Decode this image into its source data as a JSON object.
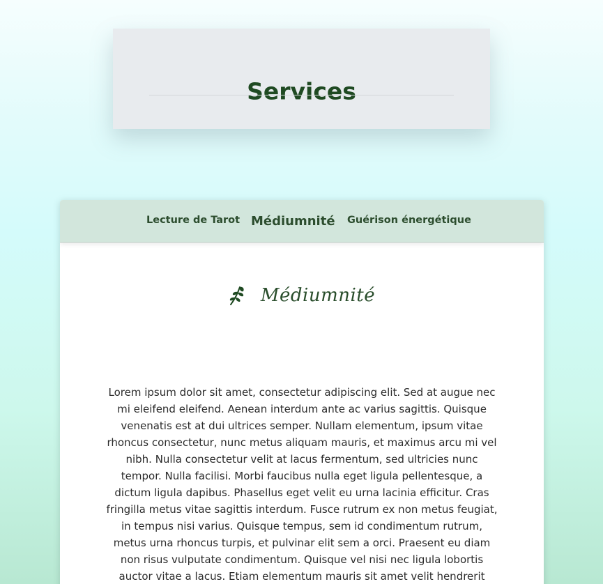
{
  "hero": {
    "title": "Services"
  },
  "tabs": [
    {
      "label": "Lecture de Tarot",
      "active": false
    },
    {
      "label": "Médiumnité",
      "active": true
    },
    {
      "label": "Guérison énergétique",
      "active": false
    }
  ],
  "section": {
    "icon": "leaf-branch-icon",
    "title": "Médiumnité",
    "body": "Lorem ipsum dolor sit amet, consectetur adipiscing elit. Sed at augue nec mi eleifend eleifend. Aenean interdum ante ac varius sagittis. Quisque venenatis est at dui ultrices semper. Nullam elementum, ipsum vitae rhoncus consectetur, nunc metus aliquam mauris, et maximus arcu mi vel nibh. Nulla consectetur velit at lacus fermentum, sed ultricies nunc tempor. Nulla facilisi. Morbi faucibus nulla eget ligula pellentesque, a dictum ligula dapibus. Phasellus eget velit eu urna lacinia efficitur. Cras fringilla metus vitae sagittis interdum. Fusce rutrum ex non metus feugiat, in tempus nisi varius. Quisque tempus, sem id condimentum rutrum, metus urna rhoncus turpis, et pulvinar elit sem a orci. Praesent eu diam non risus vulputate condimentum. Quisque vel nisi nec ligula lobortis auctor vitae a lacus. Etiam elementum mauris sit amet velit hendrerit interdum."
  },
  "colors": {
    "primary_green": "#1f4a22",
    "tab_bar_bg": "#d2e6dc",
    "hero_bg": "#e8ebee"
  }
}
